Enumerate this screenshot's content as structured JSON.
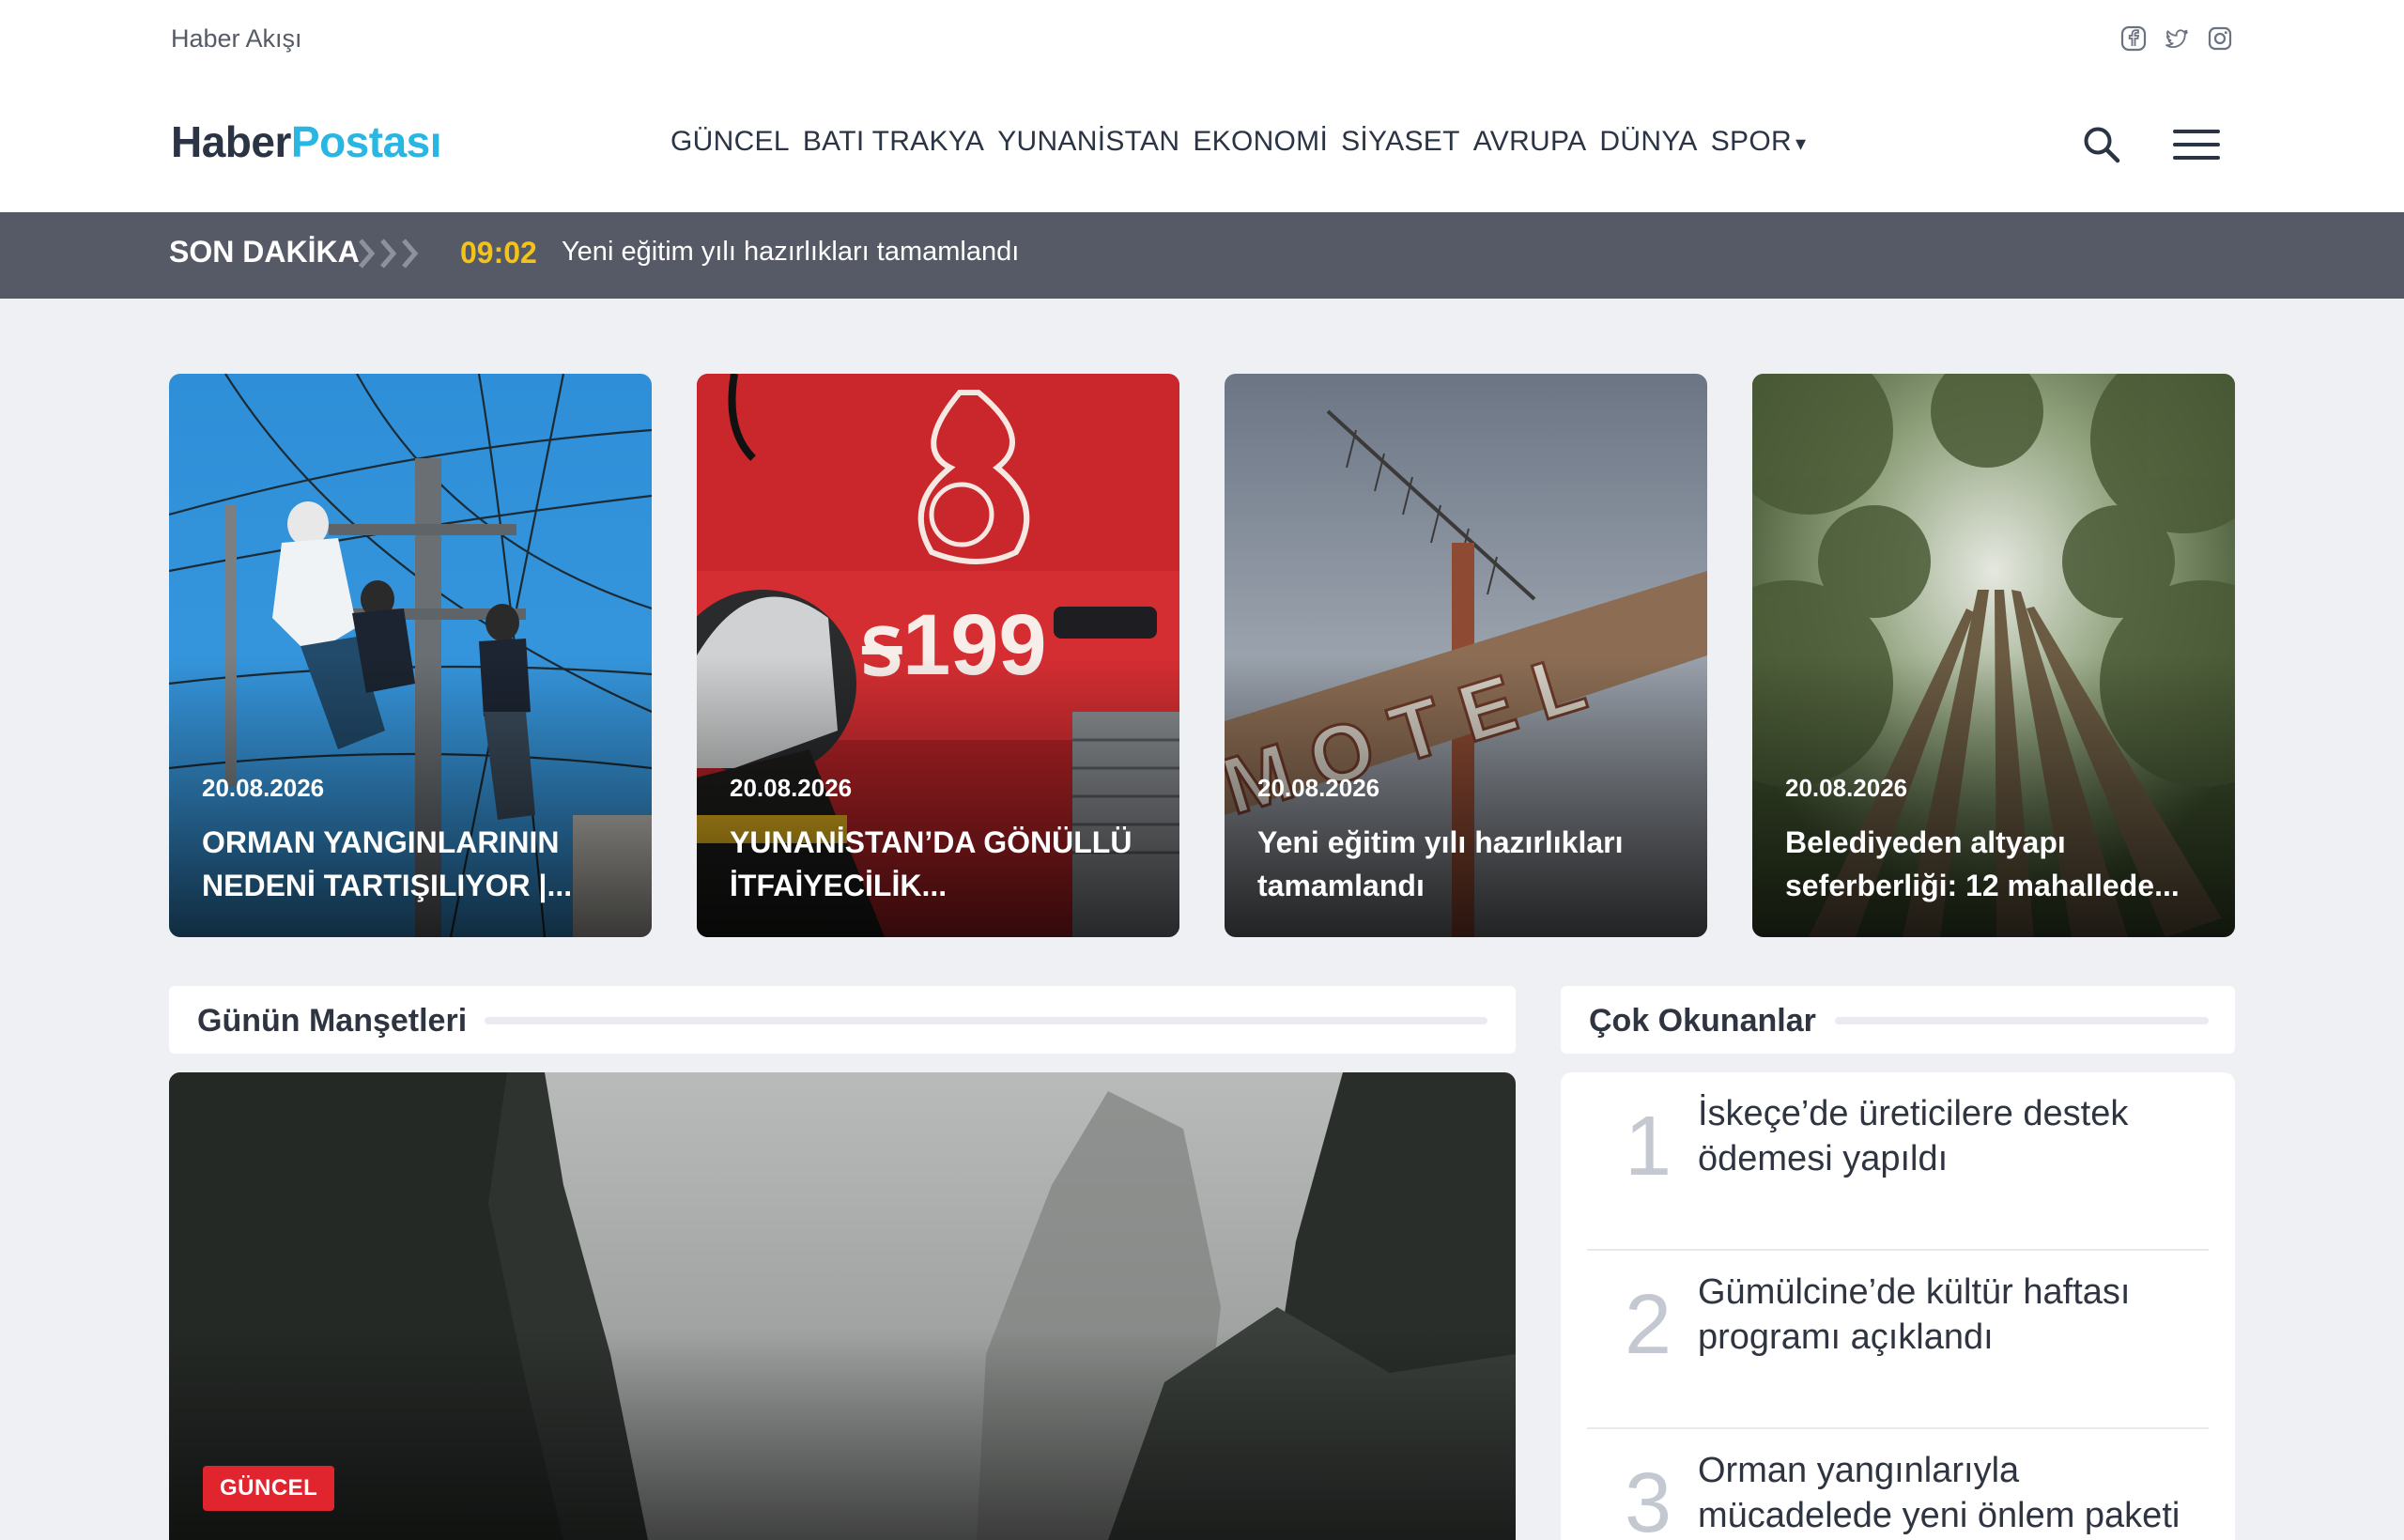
{
  "topbar": {
    "flow_label": "Haber Akışı",
    "social": [
      "facebook-icon",
      "twitter-icon",
      "instagram-icon"
    ]
  },
  "header": {
    "logo_part1": "Haber",
    "logo_part2": "Postası",
    "nav": [
      "GÜNCEL",
      "BATI TRAKYA",
      "YUNANİSTAN",
      "EKONOMİ",
      "SİYASET",
      "AVRUPA",
      "DÜNYA",
      "SPOR"
    ],
    "nav_caret": "▾"
  },
  "breaking": {
    "label": "SON DAKİKA",
    "time": "09:02",
    "text": "Yeni eğitim yılı hazırlıkları tamamlandı"
  },
  "cards": [
    {
      "date": "20.08.2026",
      "title": "ORMAN YANGINLARININ NEDENİ TARTIŞILIYOR |..."
    },
    {
      "date": "20.08.2026",
      "title": "YUNANİSTAN’DA GÖNÜLLÜ İTFAİYECİLİK..."
    },
    {
      "date": "20.08.2026",
      "title": "Yeni eğitim yılı hazırlıkları tamamlandı"
    },
    {
      "date": "20.08.2026",
      "title": "Belediyeden altyapı seferberliği: 12 mahallede..."
    }
  ],
  "headlines": {
    "title": "Günün Manşetleri",
    "feature_badge": "GÜNCEL"
  },
  "popular": {
    "title": "Çok Okunanlar",
    "items": [
      {
        "num": "1",
        "text": "İskeçe’de üreticilere destek ödemesi yapıldı"
      },
      {
        "num": "2",
        "text": "Gümülcine’de kültür haftası programı açıklandı"
      },
      {
        "num": "3",
        "text": "Orman yangınlarıyla mücadelede yeni önlem paketi"
      }
    ]
  },
  "colors": {
    "accent": "#29b6e3",
    "breaking_bg": "#565a66",
    "breaking_time": "#f3c319",
    "badge": "#e1252f"
  }
}
